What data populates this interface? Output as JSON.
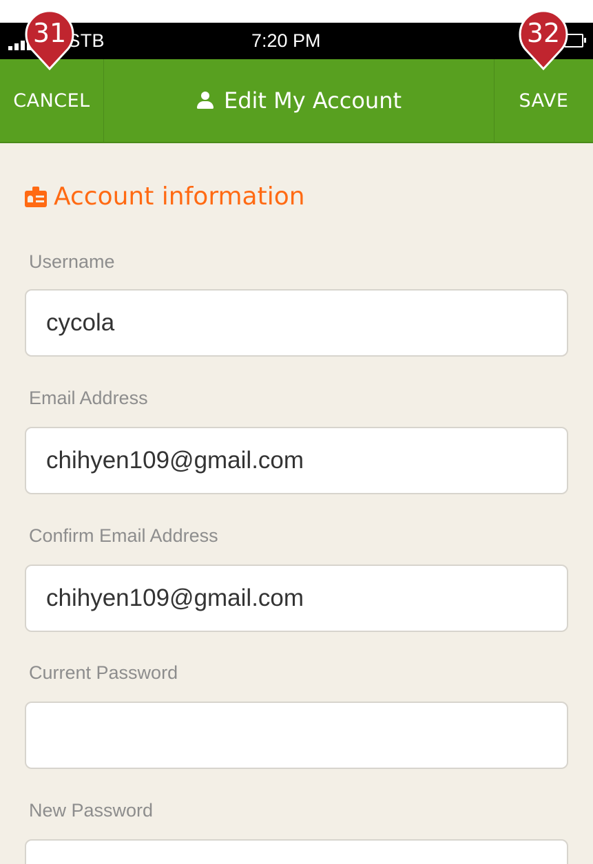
{
  "status_bar": {
    "carrier": "HW-STB",
    "time": "7:20 PM"
  },
  "nav": {
    "cancel_label": "CANCEL",
    "title": "Edit My Account",
    "save_label": "SAVE"
  },
  "section": {
    "title": "Account information"
  },
  "fields": [
    {
      "label": "Username",
      "value": "cycola"
    },
    {
      "label": "Email Address",
      "value": "chihyen109@gmail.com"
    },
    {
      "label": "Confirm Email Address",
      "value": "chihyen109@gmail.com"
    },
    {
      "label": "Current Password",
      "value": ""
    },
    {
      "label": "New Password",
      "value": ""
    }
  ],
  "markers": [
    {
      "number": "31"
    },
    {
      "number": "32"
    }
  ],
  "colors": {
    "nav_green": "#58a020",
    "section_orange": "#ff6a13",
    "background": "#f3efe6",
    "marker_red": "#c0252f"
  }
}
